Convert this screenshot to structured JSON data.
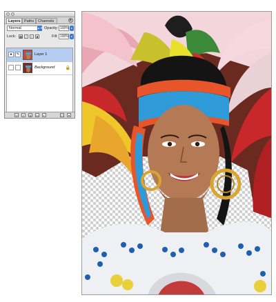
{
  "palette": {
    "tabs": [
      "Layers",
      "Paths",
      "Channels"
    ],
    "active_tab": "Layers",
    "blend_mode": "Normal",
    "opacity_label": "Opacity:",
    "opacity_value": "100%",
    "lock_label": "Lock:",
    "fill_label": "Fill:",
    "fill_value": "100%",
    "menu_icon": "palette-menu-icon",
    "layers": [
      {
        "name": "Layer 1",
        "selected": true,
        "visible": true
      },
      {
        "name": "Background",
        "selected": false,
        "visible": false,
        "locked": true
      }
    ],
    "bottom_icons": [
      "link-layers-icon",
      "layer-style-icon",
      "layer-mask-icon",
      "new-group-icon",
      "adjustment-layer-icon",
      "new-layer-icon",
      "trash-icon"
    ]
  },
  "canvas": {
    "subject": "photo-layer",
    "transparency": "checkerboard"
  },
  "colors": {
    "accent": "#3a7bd5",
    "selection": "#b4cdf0"
  }
}
